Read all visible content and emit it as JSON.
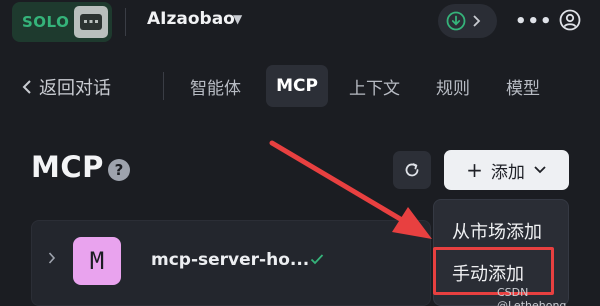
{
  "topbar": {
    "badge_text": "SOLO",
    "workspace_name": "AIzaobao",
    "icons": {
      "badge": "robot-chat-icon",
      "download": "download-circle-icon",
      "more": "more-horizontal-icon",
      "user": "user-circle-icon"
    }
  },
  "nav": {
    "back_label": "返回对话",
    "tabs": [
      {
        "label": "智能体",
        "active": false
      },
      {
        "label": "MCP",
        "active": true
      },
      {
        "label": "上下文",
        "active": false
      },
      {
        "label": "规则",
        "active": false
      },
      {
        "label": "模型",
        "active": false
      }
    ]
  },
  "header": {
    "title": "MCP",
    "help_symbol": "?",
    "add_label": "添加",
    "add_plus": "+"
  },
  "servers": [
    {
      "avatar_letter": "M",
      "name": "mcp-server-ho...",
      "status": "connected"
    }
  ],
  "add_menu": {
    "items": [
      {
        "label": "从市场添加",
        "highlighted": false
      },
      {
        "label": "手动添加",
        "highlighted": true
      }
    ]
  },
  "watermark": "CSDN @Lethehong",
  "colors": {
    "background": "#1b1d22",
    "accent_green": "#35b37a",
    "annotation_red": "#e84040",
    "avatar_pink": "#e9a3ee"
  }
}
